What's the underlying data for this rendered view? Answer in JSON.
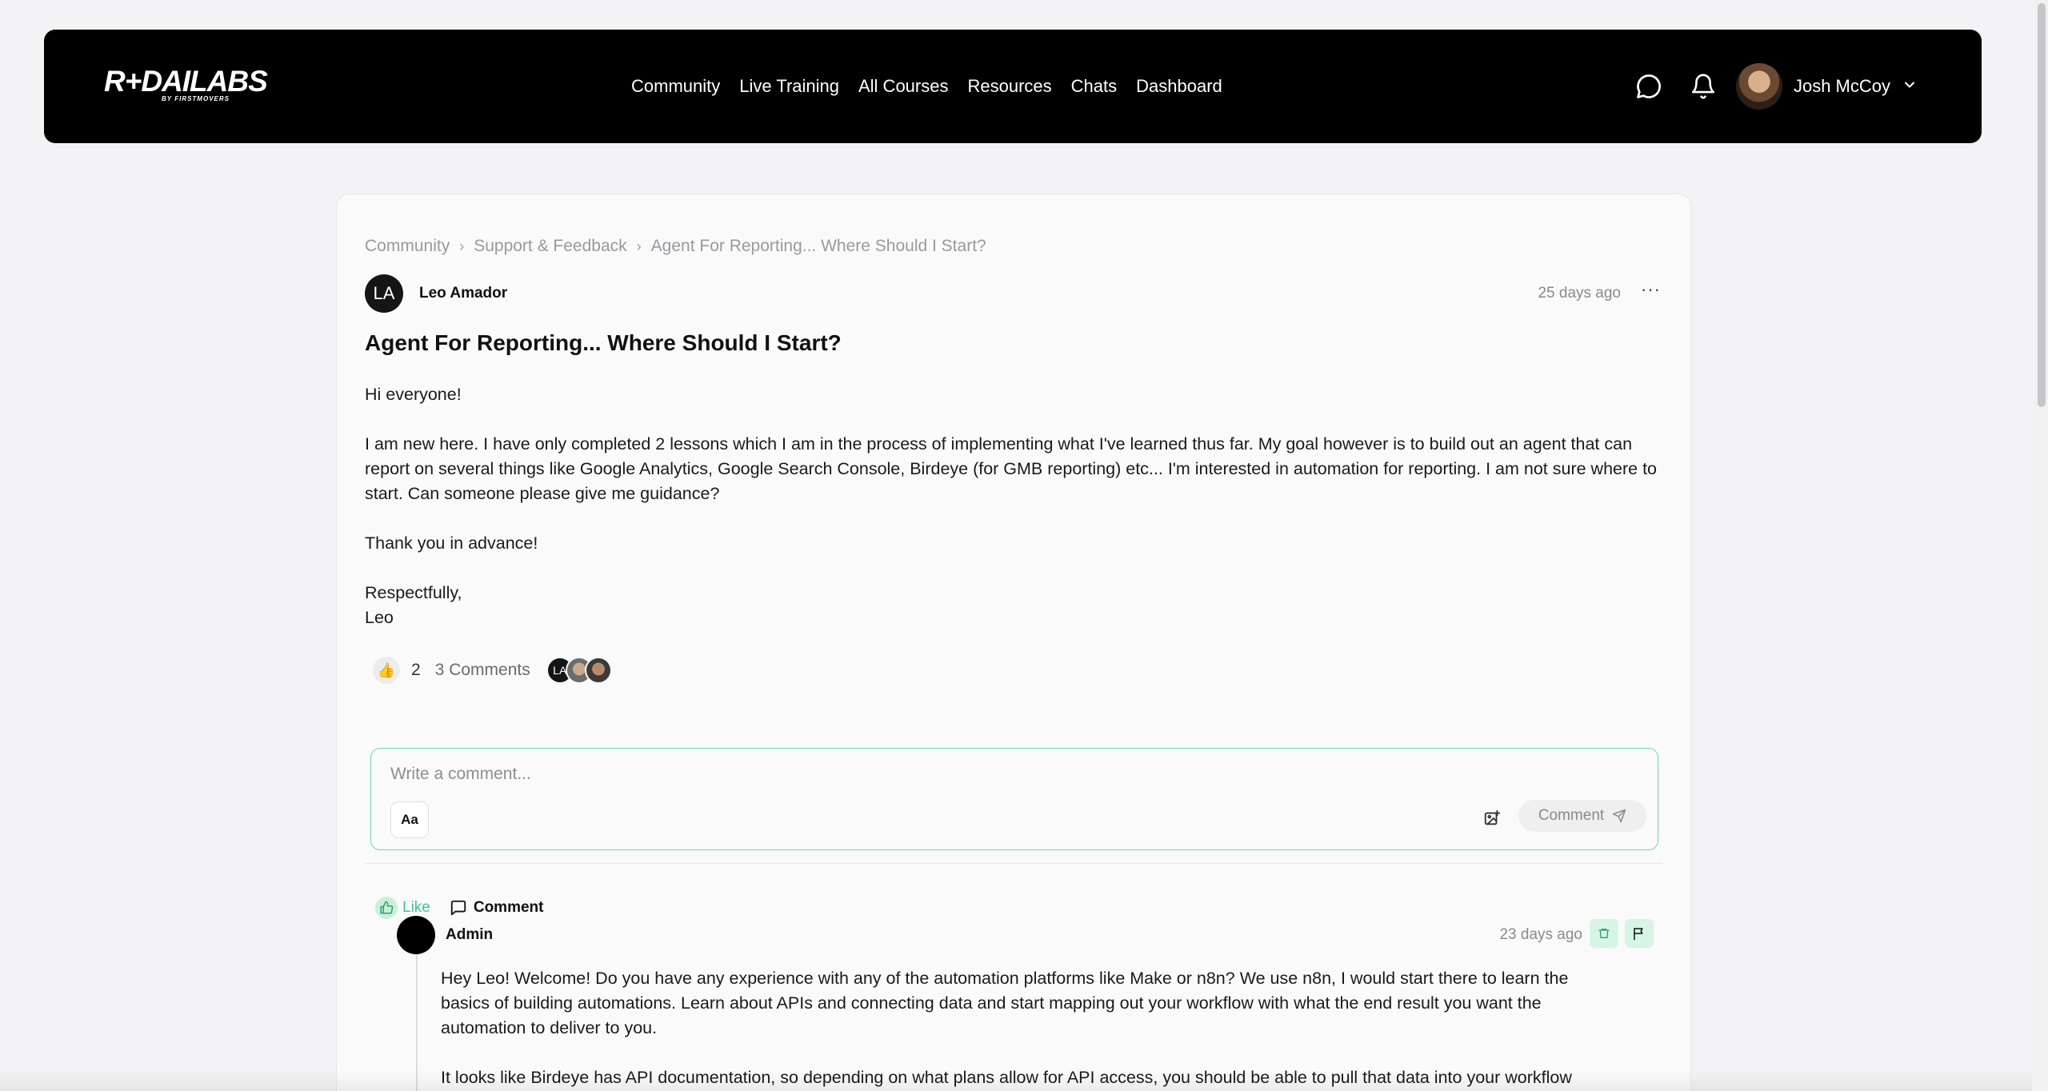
{
  "header": {
    "logo_text_main": "R+DAILABS",
    "logo_text_sub": "BY FIRSTMOVERS",
    "nav": [
      "Community",
      "Live Training",
      "All Courses",
      "Resources",
      "Chats",
      "Dashboard"
    ],
    "user_name": "Josh McCoy",
    "icons": [
      "chat-bubble-icon",
      "bell-icon",
      "chevron-down-icon"
    ]
  },
  "breadcrumb": {
    "items": [
      "Community",
      "Support & Feedback",
      "Agent For Reporting... Where Should I Start?"
    ],
    "separator": "›"
  },
  "post": {
    "author_initials": "LA",
    "author": "Leo Amador",
    "time": "25 days ago",
    "more": "···",
    "title": "Agent For Reporting... Where Should I Start?",
    "body": [
      "Hi everyone!",
      "I am new here. I have only completed 2 lessons which I am in the process of implementing what I've learned thus far. My goal however is to build out an agent that can report on several things like Google Analytics, Google Search Console, Birdeye (for GMB reporting) etc... I'm interested in automation for reporting. I am not sure where to start. Can someone please give me guidance?",
      "Thank you in advance!",
      "Respectfully,",
      "Leo"
    ],
    "reaction_emoji": "👍",
    "like_count": "2",
    "comments_label": "3 Comments",
    "like_label": "Like",
    "comment_label": "Comment"
  },
  "composer": {
    "placeholder": "Write a comment...",
    "format_label": "Aa",
    "submit_label": "Comment"
  },
  "comment": {
    "author": "Admin",
    "time": "23 days ago",
    "body": [
      "Hey Leo! Welcome! Do you have any experience with any of the automation platforms like Make or n8n? We use n8n, I would start there to learn the basics of building automations. Learn about APIs and connecting data and start mapping out your workflow with what the end result you want the automation to deliver to you.",
      "It looks like Birdeye has API documentation, so depending on what plans allow for API access, you should be able to pull that data into your workflow"
    ]
  },
  "colors": {
    "accent_green": "#3fc78a",
    "composer_border": "#74d6a7",
    "topbar": "#000000",
    "page_bg": "#f3f3f5"
  }
}
